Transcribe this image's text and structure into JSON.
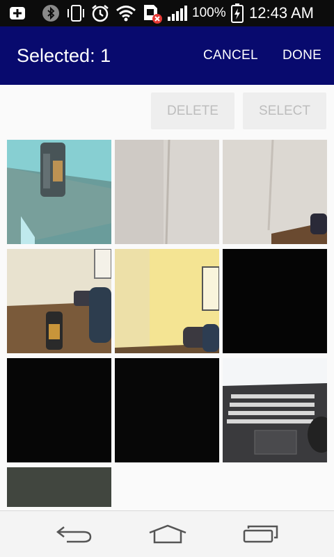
{
  "status_bar": {
    "battery_percent": "100%",
    "time": "12:43 AM",
    "icons": [
      "add-notification-icon",
      "bluetooth-icon",
      "vibrate-icon",
      "alarm-icon",
      "wifi-icon",
      "sim-error-icon",
      "signal-icon",
      "battery-charging-icon"
    ]
  },
  "app_bar": {
    "title": "Selected: 1",
    "cancel_label": "CANCEL",
    "done_label": "DONE"
  },
  "toolbar": {
    "delete_label": "DELETE",
    "select_label": "SELECT"
  },
  "photos": [
    {
      "name": "photo-energy-can-on-table"
    },
    {
      "name": "photo-white-wall"
    },
    {
      "name": "photo-wall-corner-desk"
    },
    {
      "name": "photo-can-on-desk"
    },
    {
      "name": "photo-yellow-room"
    },
    {
      "name": "photo-black-1"
    },
    {
      "name": "photo-black-2"
    },
    {
      "name": "photo-black-3"
    },
    {
      "name": "photo-laptop-keyboard"
    },
    {
      "name": "photo-dark-partial"
    }
  ],
  "nav_bar": {
    "icons": [
      "back-icon",
      "home-icon",
      "recents-icon"
    ]
  }
}
